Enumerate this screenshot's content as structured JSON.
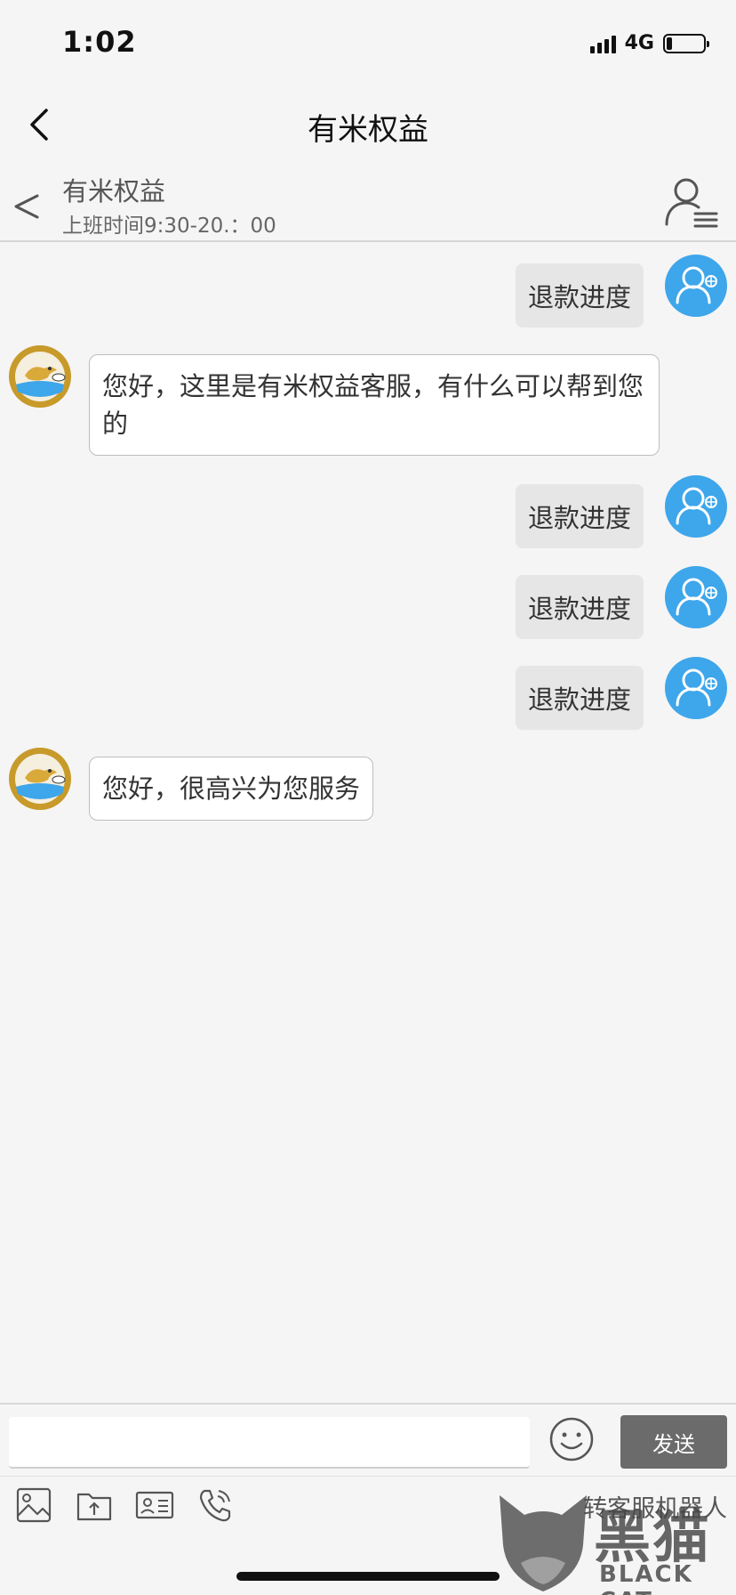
{
  "status_bar": {
    "time": "1:02",
    "network": "4G",
    "battery_level": 0.15,
    "icons": [
      "signal-icon",
      "battery-icon"
    ]
  },
  "nav": {
    "title": "有米权益",
    "back_icon": "chevron-left-icon"
  },
  "chat_header": {
    "name": "有米权益",
    "hours": "上班时间9:30-20.：00",
    "back_icon": "chevron-left-icon",
    "profile_icon": "user-list-icon"
  },
  "messages": [
    {
      "side": "out",
      "text": "退款进度"
    },
    {
      "side": "in",
      "text": "您好，这里是有米权益客服，有什么可以帮到您的"
    },
    {
      "side": "out",
      "text": "退款进度"
    },
    {
      "side": "out",
      "text": "退款进度"
    },
    {
      "side": "out",
      "text": "退款进度"
    },
    {
      "side": "in",
      "text": "您好，很高兴为您服务"
    }
  ],
  "input": {
    "value": "",
    "send_label": "发送",
    "emoji_icon": "smiley-icon"
  },
  "toolbar": {
    "items": [
      "image-icon",
      "file-upload-icon",
      "contact-card-icon",
      "phone-icon"
    ],
    "transfer_label": "转客服机器人"
  },
  "watermark": {
    "cn": "黑猫",
    "en": "BLACK CAT"
  },
  "colors": {
    "user_avatar": "#3ea6ea",
    "bot_avatar": "#c79a2a",
    "send_button": "#6b6b6b",
    "background": "#f5f5f5"
  }
}
